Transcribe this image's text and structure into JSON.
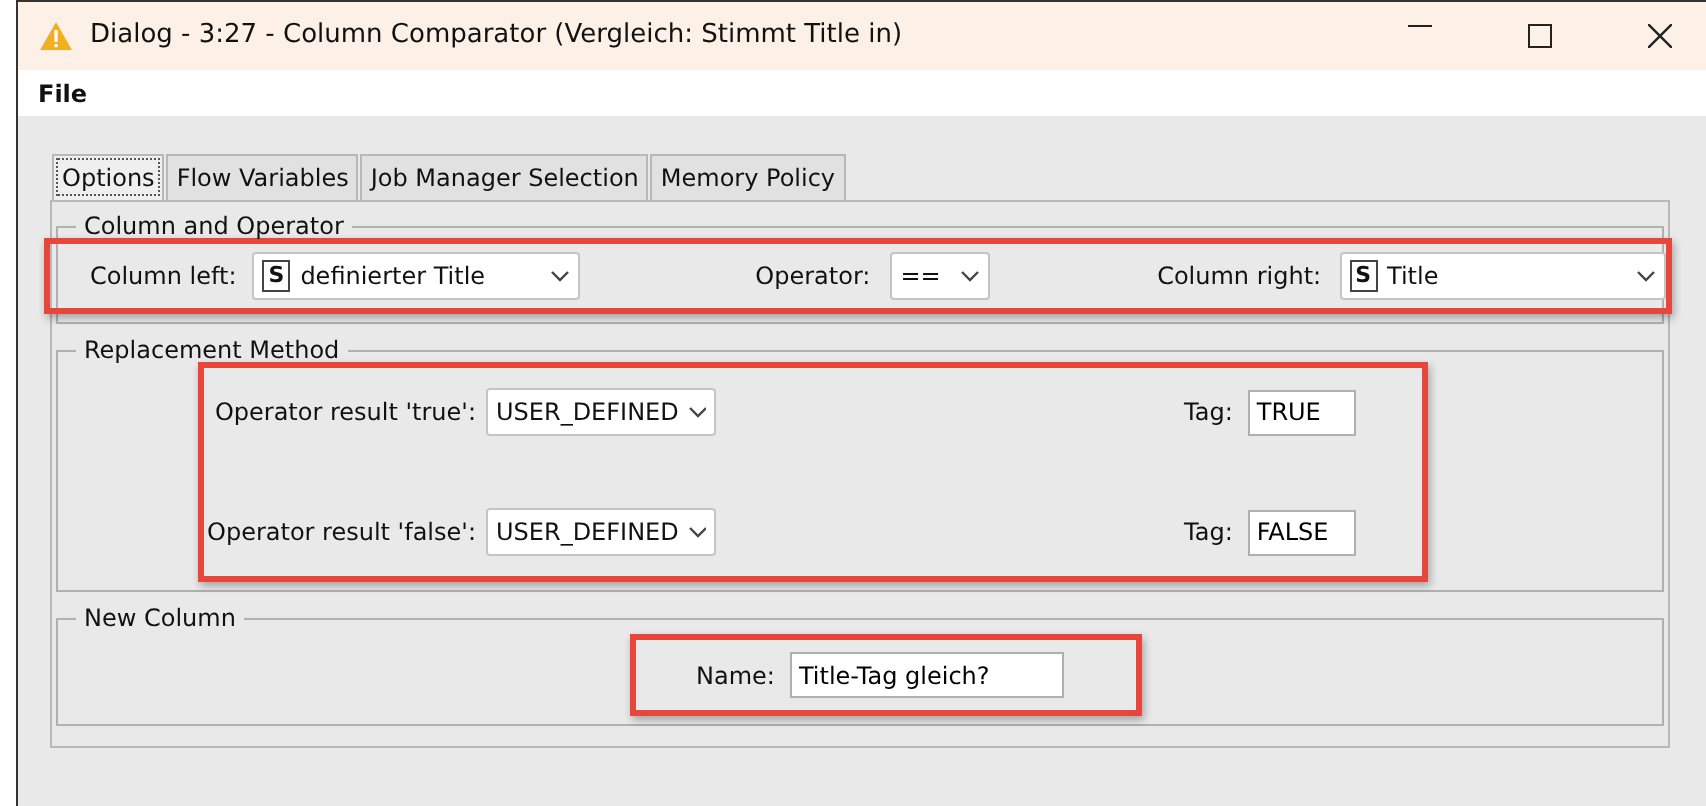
{
  "window": {
    "title": "Dialog - 3:27 - Column Comparator (Vergleich: Stimmt Title in)"
  },
  "menu": [
    "File"
  ],
  "tabs": [
    {
      "label": "Options",
      "selected": true
    },
    {
      "label": "Flow Variables",
      "selected": false
    },
    {
      "label": "Job Manager Selection",
      "selected": false
    },
    {
      "label": "Memory Policy",
      "selected": false
    }
  ],
  "column_and_operator": {
    "title": "Column and Operator",
    "highlighted": true,
    "column_left": {
      "label": "Column left:",
      "type": "S",
      "value": "definierter Title"
    },
    "operator": {
      "label": "Operator:",
      "value": "=="
    },
    "column_right": {
      "label": "Column right:",
      "type": "S",
      "value": "Title"
    }
  },
  "replacement_method": {
    "title": "Replacement Method",
    "highlighted": true,
    "rows": [
      {
        "label": "Operator result 'true':",
        "method": "USER_DEFINED",
        "tag_label": "Tag:",
        "tag_value": "TRUE"
      },
      {
        "label": "Operator result 'false':",
        "method": "USER_DEFINED",
        "tag_label": "Tag:",
        "tag_value": "FALSE"
      }
    ]
  },
  "new_column": {
    "title": "New Column",
    "highlighted": true,
    "name_label": "Name:",
    "name_value": "Title-Tag gleich?"
  }
}
